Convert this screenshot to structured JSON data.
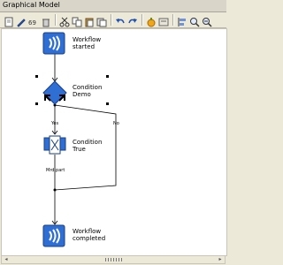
{
  "window": {
    "title": "Graphical Model"
  },
  "toolbar": {
    "buttons": [
      "new-icon",
      "edit-icon",
      "stats-icon",
      "delete-icon",
      "cut-icon",
      "copy-icon",
      "paste-icon",
      "copy-alt-icon",
      "undo-icon",
      "redo-icon",
      "run-icon",
      "debug-icon",
      "align-icon",
      "zoom-in-icon",
      "zoom-out-icon"
    ]
  },
  "diagram": {
    "nodes": {
      "start": {
        "label_line1": "Workflow",
        "label_line2": "started"
      },
      "decision": {
        "label_line1": "Condition",
        "label_line2": "Demo"
      },
      "true_node": {
        "label_line1": "Condition",
        "label_line2": "True"
      },
      "end": {
        "label_line1": "Workflow",
        "label_line2": "completed"
      }
    },
    "edges": {
      "yes_label": "Yes",
      "no_label": "No",
      "merge_label": "Mrd.part"
    }
  },
  "colors": {
    "node_blue": "#2f6fd3",
    "node_dark": "#1f4fa8",
    "accent_orange": "#f2a51a"
  }
}
